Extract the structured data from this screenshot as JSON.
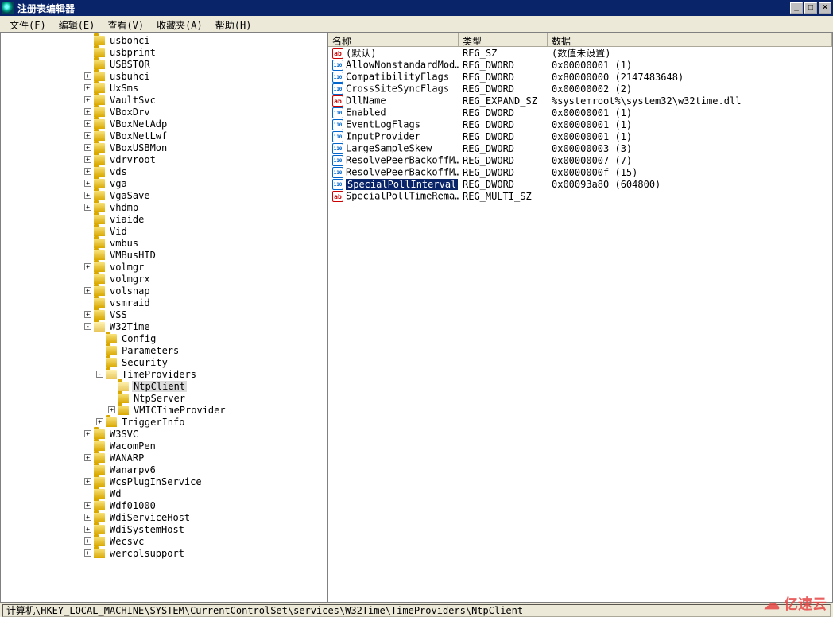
{
  "window": {
    "title": "注册表编辑器",
    "buttons": {
      "min": "_",
      "max": "□",
      "close": "×"
    }
  },
  "menu": {
    "file": "文件(F)",
    "edit": "编辑(E)",
    "view": "查看(V)",
    "favorites": "收藏夹(A)",
    "help": "帮助(H)"
  },
  "tree": [
    {
      "depth": 7,
      "exp": "",
      "label": "usbohci"
    },
    {
      "depth": 7,
      "exp": "",
      "label": "usbprint"
    },
    {
      "depth": 7,
      "exp": "",
      "label": "USBSTOR"
    },
    {
      "depth": 7,
      "exp": "+",
      "label": "usbuhci"
    },
    {
      "depth": 7,
      "exp": "+",
      "label": "UxSms"
    },
    {
      "depth": 7,
      "exp": "+",
      "label": "VaultSvc"
    },
    {
      "depth": 7,
      "exp": "+",
      "label": "VBoxDrv"
    },
    {
      "depth": 7,
      "exp": "+",
      "label": "VBoxNetAdp"
    },
    {
      "depth": 7,
      "exp": "+",
      "label": "VBoxNetLwf"
    },
    {
      "depth": 7,
      "exp": "+",
      "label": "VBoxUSBMon"
    },
    {
      "depth": 7,
      "exp": "+",
      "label": "vdrvroot"
    },
    {
      "depth": 7,
      "exp": "+",
      "label": "vds"
    },
    {
      "depth": 7,
      "exp": "+",
      "label": "vga"
    },
    {
      "depth": 7,
      "exp": "+",
      "label": "VgaSave"
    },
    {
      "depth": 7,
      "exp": "+",
      "label": "vhdmp"
    },
    {
      "depth": 7,
      "exp": "",
      "label": "viaide"
    },
    {
      "depth": 7,
      "exp": "",
      "label": "Vid"
    },
    {
      "depth": 7,
      "exp": "",
      "label": "vmbus"
    },
    {
      "depth": 7,
      "exp": "",
      "label": "VMBusHID"
    },
    {
      "depth": 7,
      "exp": "+",
      "label": "volmgr"
    },
    {
      "depth": 7,
      "exp": "",
      "label": "volmgrx"
    },
    {
      "depth": 7,
      "exp": "+",
      "label": "volsnap"
    },
    {
      "depth": 7,
      "exp": "",
      "label": "vsmraid"
    },
    {
      "depth": 7,
      "exp": "+",
      "label": "VSS"
    },
    {
      "depth": 7,
      "exp": "-",
      "label": "W32Time",
      "open": true
    },
    {
      "depth": 8,
      "exp": "",
      "label": "Config"
    },
    {
      "depth": 8,
      "exp": "",
      "label": "Parameters"
    },
    {
      "depth": 8,
      "exp": "",
      "label": "Security"
    },
    {
      "depth": 8,
      "exp": "-",
      "label": "TimeProviders",
      "open": true
    },
    {
      "depth": 9,
      "exp": "",
      "label": "NtpClient",
      "open": true,
      "selected": true
    },
    {
      "depth": 9,
      "exp": "",
      "label": "NtpServer"
    },
    {
      "depth": 9,
      "exp": "+",
      "label": "VMICTimeProvider"
    },
    {
      "depth": 8,
      "exp": "+",
      "label": "TriggerInfo"
    },
    {
      "depth": 7,
      "exp": "+",
      "label": "W3SVC"
    },
    {
      "depth": 7,
      "exp": "",
      "label": "WacomPen"
    },
    {
      "depth": 7,
      "exp": "+",
      "label": "WANARP"
    },
    {
      "depth": 7,
      "exp": "",
      "label": "Wanarpv6"
    },
    {
      "depth": 7,
      "exp": "+",
      "label": "WcsPlugInService"
    },
    {
      "depth": 7,
      "exp": "",
      "label": "Wd"
    },
    {
      "depth": 7,
      "exp": "+",
      "label": "Wdf01000"
    },
    {
      "depth": 7,
      "exp": "+",
      "label": "WdiServiceHost"
    },
    {
      "depth": 7,
      "exp": "+",
      "label": "WdiSystemHost"
    },
    {
      "depth": 7,
      "exp": "+",
      "label": "Wecsvc"
    },
    {
      "depth": 7,
      "exp": "+",
      "label": "wercplsupport"
    }
  ],
  "list": {
    "headers": {
      "name": "名称",
      "type": "类型",
      "data": "数据"
    },
    "rows": [
      {
        "icon": "str",
        "name": "(默认)",
        "type": "REG_SZ",
        "data": "(数值未设置)"
      },
      {
        "icon": "bin",
        "name": "AllowNonstandardMod…",
        "type": "REG_DWORD",
        "data": "0x00000001 (1)"
      },
      {
        "icon": "bin",
        "name": "CompatibilityFlags",
        "type": "REG_DWORD",
        "data": "0x80000000 (2147483648)"
      },
      {
        "icon": "bin",
        "name": "CrossSiteSyncFlags",
        "type": "REG_DWORD",
        "data": "0x00000002 (2)"
      },
      {
        "icon": "str",
        "name": "DllName",
        "type": "REG_EXPAND_SZ",
        "data": "%systemroot%\\system32\\w32time.dll"
      },
      {
        "icon": "bin",
        "name": "Enabled",
        "type": "REG_DWORD",
        "data": "0x00000001 (1)"
      },
      {
        "icon": "bin",
        "name": "EventLogFlags",
        "type": "REG_DWORD",
        "data": "0x00000001 (1)"
      },
      {
        "icon": "bin",
        "name": "InputProvider",
        "type": "REG_DWORD",
        "data": "0x00000001 (1)"
      },
      {
        "icon": "bin",
        "name": "LargeSampleSkew",
        "type": "REG_DWORD",
        "data": "0x00000003 (3)"
      },
      {
        "icon": "bin",
        "name": "ResolvePeerBackoffM…",
        "type": "REG_DWORD",
        "data": "0x00000007 (7)"
      },
      {
        "icon": "bin",
        "name": "ResolvePeerBackoffM…",
        "type": "REG_DWORD",
        "data": "0x0000000f (15)"
      },
      {
        "icon": "bin",
        "name": "SpecialPollInterval",
        "type": "REG_DWORD",
        "data": "0x00093a80 (604800)",
        "selected": true
      },
      {
        "icon": "str",
        "name": "SpecialPollTimeRema…",
        "type": "REG_MULTI_SZ",
        "data": ""
      }
    ]
  },
  "statusbar": {
    "path": "计算机\\HKEY_LOCAL_MACHINE\\SYSTEM\\CurrentControlSet\\services\\W32Time\\TimeProviders\\NtpClient"
  },
  "watermark": "亿速云"
}
